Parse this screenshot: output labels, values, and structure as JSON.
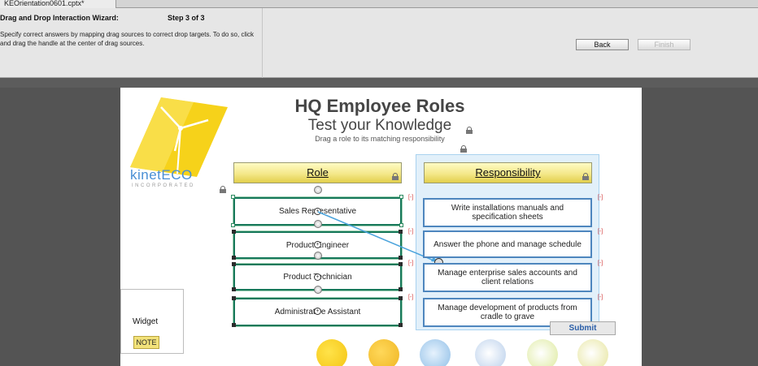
{
  "tab": {
    "filename": "KEOrientation0601.cptx*"
  },
  "wizard": {
    "title": "Drag and Drop Interaction Wizard:",
    "step": "Step 3 of 3",
    "description": "Specify correct answers by mapping drag sources to correct drop targets. To do so, click and drag the handle at the center of drag sources.",
    "back_label": "Back",
    "finish_label": "Finish"
  },
  "slide": {
    "logo_text": "kinetECO",
    "logo_sub": "INCORPORATED",
    "title": "HQ Employee Roles",
    "subtitle": "Test your Knowledge",
    "instruction": "Drag a role to its matching responsibility",
    "role_header": "Role",
    "responsibility_header": "Responsibility",
    "roles": [
      {
        "label": "Sales Representative"
      },
      {
        "label": "Product Engineer"
      },
      {
        "label": "Product Technician"
      },
      {
        "label": "Administrative Assistant"
      }
    ],
    "responsibilities": [
      {
        "label": "Write installations manuals and specification sheets"
      },
      {
        "label": "Answer the phone and manage schedule"
      },
      {
        "label": "Manage enterprise sales accounts and client relations"
      },
      {
        "label": "Manage development of products from cradle to grave"
      }
    ],
    "widget_label": "Widget",
    "note_label": "NOTE",
    "submit_label": "Submit",
    "delete_marker": "[-]"
  },
  "colors": {
    "source_border": "#16785a",
    "target_border": "#4e86be",
    "header_fill": "#f4e88a",
    "connector": "#4aa3dc",
    "submit_text": "#2a5ea8"
  }
}
